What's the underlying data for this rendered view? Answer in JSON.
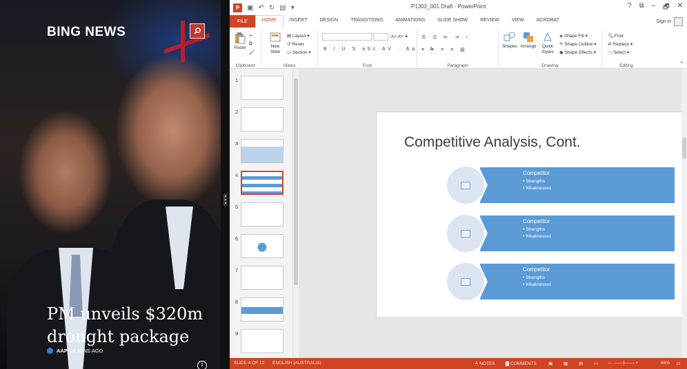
{
  "news": {
    "app_title": "BING NEWS",
    "headline": "PM unveils $320m drought package",
    "source": "AAP",
    "time": "16 MINS AGO"
  },
  "ppt": {
    "window_title": "P1302_001 Draft - PowerPoint",
    "window_controls": [
      "?",
      "⧉",
      "–",
      "🗗",
      "✕"
    ],
    "tabs": [
      "FILE",
      "HOME",
      "INSERT",
      "DESIGN",
      "TRANSITIONS",
      "ANIMATIONS",
      "SLIDE SHOW",
      "REVIEW",
      "VIEW",
      "ACROBAT"
    ],
    "active_tab": "HOME",
    "sign_in": "Sign in",
    "ribbon": {
      "clipboard": {
        "label": "Clipboard",
        "paste": "Paste"
      },
      "slides": {
        "label": "Slides",
        "new_slide": "New Slide",
        "layout": "Layout",
        "reset": "Reset",
        "section": "Section"
      },
      "font": {
        "label": "Font"
      },
      "paragraph": {
        "label": "Paragraph"
      },
      "drawing": {
        "label": "Drawing",
        "shapes": "Shapes",
        "arrange": "Arrange",
        "quick_styles": "Quick Styles",
        "shape_fill": "Shape Fill",
        "shape_outline": "Shape Outline",
        "shape_effects": "Shape Effects"
      },
      "editing": {
        "label": "Editing",
        "find": "Find",
        "replace": "Replace",
        "select": "Select"
      }
    },
    "thumbnails": [
      "1",
      "2",
      "3",
      "4",
      "5",
      "6",
      "7",
      "8",
      "9"
    ],
    "selected_slide": 4,
    "slide": {
      "title": "Competitive Analysis, Cont.",
      "rows": [
        {
          "heading": "Competitor",
          "bullets": [
            "Strengths",
            "Weaknesses"
          ]
        },
        {
          "heading": "Competitor",
          "bullets": [
            "Strengths",
            "Weaknesses"
          ]
        },
        {
          "heading": "Competitor",
          "bullets": [
            "Strengths",
            "Weaknesses"
          ]
        }
      ]
    },
    "status": {
      "slide_info": "SLIDE 4 OF 12",
      "language": "ENGLISH (AUSTRALIA)",
      "notes": "NOTES",
      "comments": "COMMENTS",
      "zoom": "68%"
    }
  },
  "colors": {
    "accent": "#d04423",
    "smartart_blue": "#5b9bd5",
    "bing_red": "#c0392b"
  }
}
